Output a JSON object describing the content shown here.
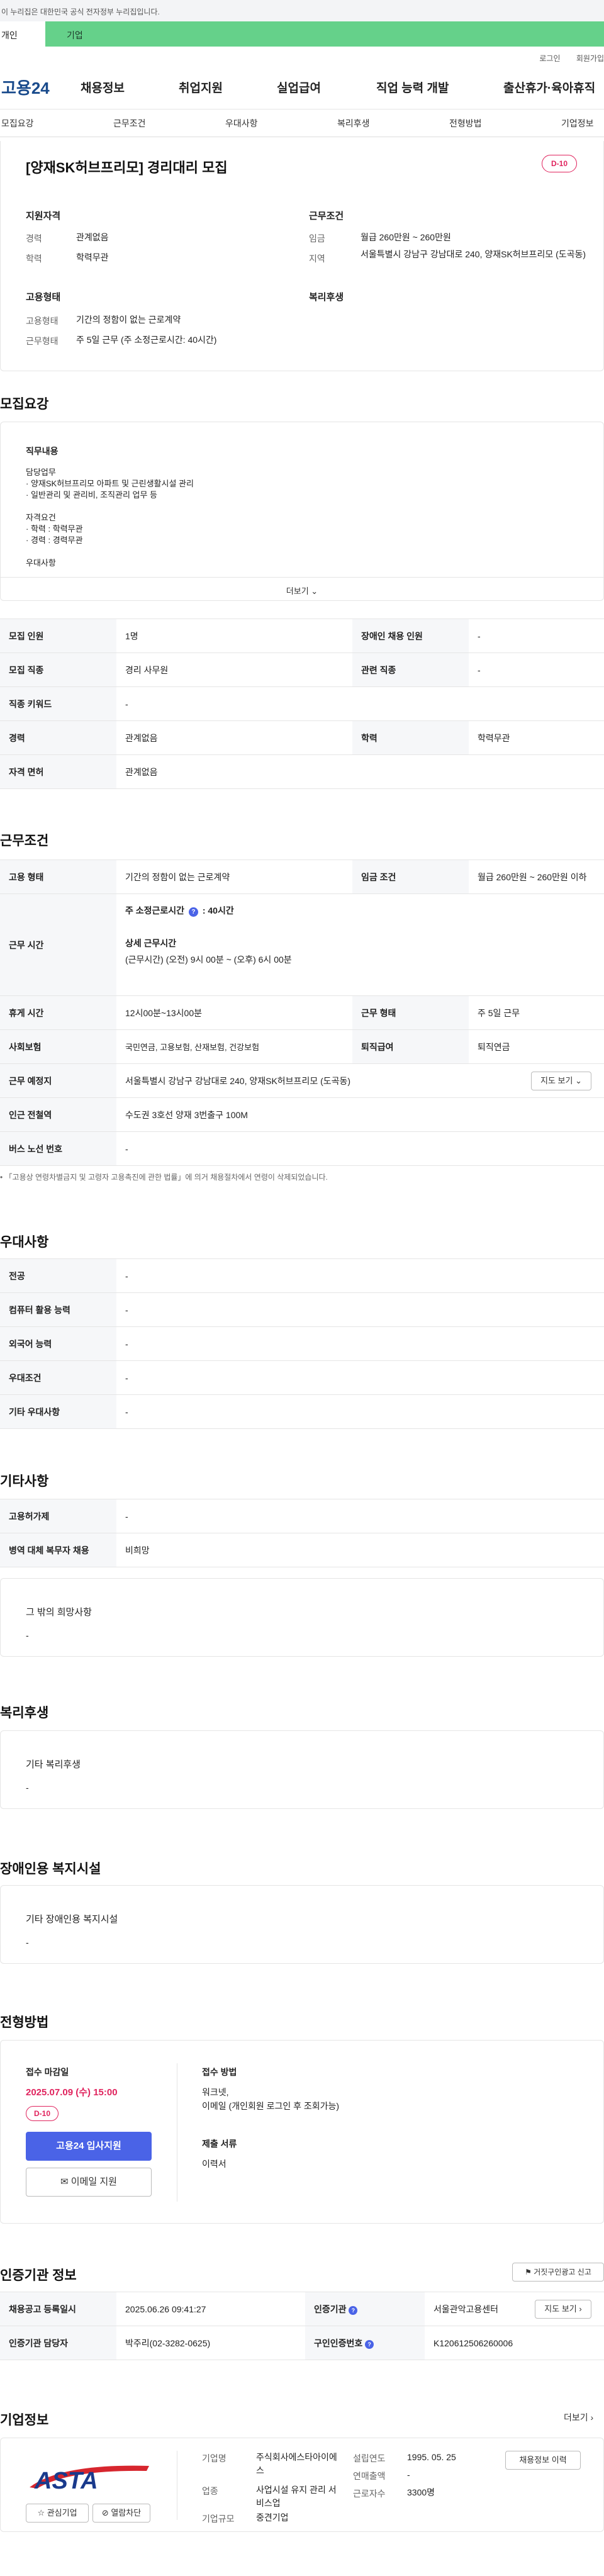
{
  "gov_notice": "이 누리집은 대한민국 공식 전자정부 누리집입니다.",
  "tabs": {
    "personal": "개인",
    "company": "기업"
  },
  "util": {
    "login": "로그인",
    "join": "회원가입"
  },
  "logo": "고용24",
  "gnb": [
    "채용정보",
    "취업지원",
    "실업급여",
    "직업 능력 개발",
    "출산휴가·육아휴직"
  ],
  "subnav": [
    "모집요강",
    "근무조건",
    "우대사항",
    "복리후생",
    "전형방법",
    "기업정보"
  ],
  "summary": {
    "title": "[양재SK허브프리모] 경리대리 모집",
    "dday": "D-10",
    "qual_title": "지원자격",
    "cond_title": "근무조건",
    "career_label": "경력",
    "career_value": "관계없음",
    "edu_label": "학력",
    "edu_value": "학력무관",
    "wage_label": "임금",
    "wage_value": "월급 260만원 ~ 260만원",
    "region_label": "지역",
    "region_value": "서울특별시 강남구 강남대로 240, 양재SK허브프리모 (도곡동)",
    "emp_title": "고용형태",
    "welfare_title": "복리후생",
    "emp_label": "고용형태",
    "emp_value": "기간의 정함이 없는 근로계약",
    "workform_label": "근무형태",
    "workform_value": "주 5일 근무 (주 소정근로시간: 40시간)"
  },
  "recruit": {
    "section_title": "모집요강",
    "job_title": "직무내용",
    "job_lines": [
      "담당업무",
      "· 양재SK허브프리모 아파트 및 근린생활시설 관리",
      "· 일반관리 및 관리비, 조직관리 업무 등",
      "",
      "자격요건",
      "· 학력 : 학력무관",
      "· 경력 : 경력무관",
      "",
      "우대사항"
    ],
    "more_label": "더보기",
    "rows": [
      {
        "l1": "모집 인원",
        "v1": "1명",
        "l2": "장애인 채용 인원",
        "v2": "-"
      },
      {
        "l1": "모집 직종",
        "v1": "경리 사무원",
        "l2": "관련 직종",
        "v2": "-"
      },
      {
        "l1": "직종 키워드",
        "v1": "-"
      },
      {
        "l1": "경력",
        "v1": "관계없음",
        "l2": "학력",
        "v2": "학력무관"
      },
      {
        "l1": "자격 면허",
        "v1": "관계없음"
      }
    ]
  },
  "conditions": {
    "section_title": "근무조건",
    "emp_type_label": "고용 형태",
    "emp_type_value": "기간의 정함이 없는 근로계약",
    "wage_label": "임금 조건",
    "wage_value": "월급 260만원 ~ 260만원 이하",
    "worktime_label": "근무 시간",
    "weekly_hours": "주 소정근로시간",
    "weekly_hours_value": ": 40시간",
    "detail_label": "상세 근무시간",
    "detail_value": "(근무시간) (오전) 9시 00분 ~ (오후) 6시 00분",
    "break_label": "휴게 시간",
    "break_value": "12시00분~13시00분",
    "workform_label": "근무 형태",
    "workform_value": "주 5일 근무",
    "insurance_label": "사회보험",
    "insurance_value": "국민연금, 고용보험, 산재보험, 건강보험",
    "retire_label": "퇴직급여",
    "retire_value": "퇴직연금",
    "place_label": "근무 예정지",
    "place_value": "서울특별시 강남구 강남대로 240, 양재SK허브프리모 (도곡동)",
    "map_label": "지도 보기",
    "subway_label": "인근 전철역",
    "subway_value": "수도권 3호선 양재 3번출구 100M",
    "bus_label": "버스 노선 번호",
    "bus_value": "-",
    "note": "「고용상 연령차별금지 및 고령자 고용촉진에 관한 법률」에 의거 채용절차에서 연령이 삭제되었습니다."
  },
  "preference": {
    "section_title": "우대사항",
    "rows": [
      {
        "label": "전공",
        "value": "-"
      },
      {
        "label": "컴퓨터 활용 능력",
        "value": "-"
      },
      {
        "label": "외국어 능력",
        "value": "-"
      },
      {
        "label": "우대조건",
        "value": "-"
      },
      {
        "label": "기타 우대사항",
        "value": "-"
      }
    ]
  },
  "etc": {
    "section_title": "기타사항",
    "rows": [
      {
        "label": "고용허가제",
        "value": "-"
      },
      {
        "label": "병역 대체 복무자 채용",
        "value": "비희망"
      }
    ],
    "other_title": "그 밖의 희망사항",
    "other_value": "-"
  },
  "welfare": {
    "section_title": "복리후생",
    "title": "기타 복리후생",
    "value": "-"
  },
  "disability": {
    "section_title": "장애인용 복지시설",
    "title": "기타 장애인용 복지시설",
    "value": "-"
  },
  "apply": {
    "section_title": "전형방법",
    "deadline_label": "접수 마감일",
    "deadline_value": "2025.07.09 (수) 15:00",
    "dday": "D-10",
    "apply_button": "고용24 입사지원",
    "email_button": "이메일 지원",
    "method_label": "접수 방법",
    "method_value1": "워크넷,",
    "method_value2": "이메일 (개인회원 로그인 후 조회가능)",
    "docs_label": "제출 서류",
    "docs_value": "이력서"
  },
  "cert": {
    "section_title": "인증기관 정보",
    "report_button": "거짓구인광고 신고",
    "date_label": "채용공고 등록일시",
    "date_value": "2025.06.26 09:41:27",
    "agency_label": "인증기관",
    "agency_value": "서울관악고용센터",
    "map_label": "지도 보기",
    "manager_label": "인증기관 담당자",
    "manager_value": "박주리(02-3282-0625)",
    "cert_no_label": "구인인증번호",
    "cert_no_value": "K120612506260006"
  },
  "company": {
    "section_title": "기업정보",
    "more_label": "더보기",
    "logo_text": "ASTA",
    "interest_button": "관심기업",
    "block_button": "열람차단",
    "name_label": "기업명",
    "name_value": "주식회사에스타아이에스",
    "industry_label": "업종",
    "industry_value": "사업시설 유지 관리 서비스업",
    "size_label": "기업규모",
    "size_value": "중견기업",
    "founded_label": "설립연도",
    "founded_value": "1995. 05. 25",
    "sales_label": "연매출액",
    "sales_value": "-",
    "workers_label": "근로자수",
    "workers_value": "3300명",
    "jobs_button": "채용정보 이력"
  },
  "colors": {
    "brand_green": "#65d18a",
    "primary": "#4a63e7",
    "dday": "#e0245e",
    "logo_blue": "#1a4b8c"
  }
}
